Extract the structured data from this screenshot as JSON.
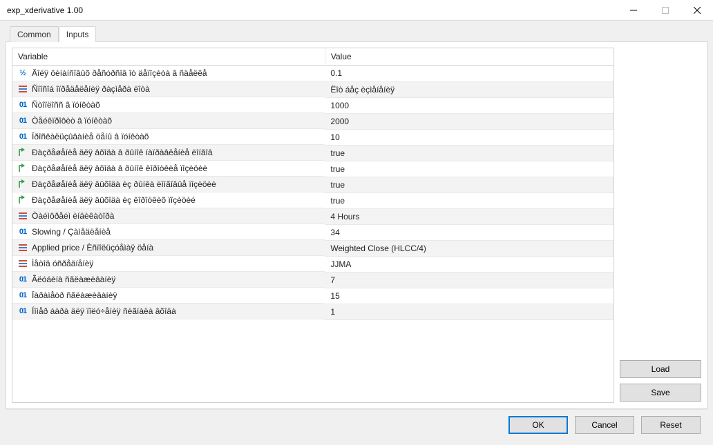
{
  "window": {
    "title": "exp_xderivative 1.00"
  },
  "tabs": {
    "common": "Common",
    "inputs": "Inputs"
  },
  "table": {
    "headers": {
      "variable": "Variable",
      "value": "Value"
    },
    "rows": [
      {
        "icon": "half-icon",
        "variable": "Äîëÿ ôèíàíñîâûõ ðåñóðñîâ îò äåïîçèòà â ñäåëêå",
        "value": "0.1"
      },
      {
        "icon": "stack-icon",
        "variable": "Ñïîñîá îïðåäåëåíèÿ ðàçìåðà ëîòà",
        "value": "Ëîò áåç èçìåíåíèÿ"
      },
      {
        "icon": "num-icon",
        "variable": "Ñòîïëîññ â ïóíêòàõ",
        "value": "1000"
      },
      {
        "icon": "num-icon",
        "variable": "Òåéêïðîôèò â ïóíêòàõ",
        "value": "2000"
      },
      {
        "icon": "num-icon",
        "variable": "Ïðîñêàëüçûâàíèå öåíû â ïóíêòàõ",
        "value": "10"
      },
      {
        "icon": "arrow-icon",
        "variable": "Ðàçðåøåíèå äëÿ âõîäà â ðûíîê íàïðàâëåíèå ëîíãîâ",
        "value": "true"
      },
      {
        "icon": "arrow-icon",
        "variable": "Ðàçðåøåíèå äëÿ âõîäà â ðûíîê êîðîòêèå ïîçèöèè",
        "value": "true"
      },
      {
        "icon": "arrow-icon",
        "variable": "Ðàçðåøåíèå äëÿ âûõîäà èç ðûíêà ëîíãîâûå ïîçèöèè",
        "value": "true"
      },
      {
        "icon": "arrow-icon",
        "variable": "Ðàçðåøåíèå äëÿ âûõîäà èç êîðîòêèõ ïîçèöèé",
        "value": "true"
      },
      {
        "icon": "stack-icon",
        "variable": "Òàéìôðåéì èíäèêàòîðà",
        "value": "4 Hours"
      },
      {
        "icon": "num-icon",
        "variable": "Slowing / Çàìåäëåíèå",
        "value": "34"
      },
      {
        "icon": "stack-icon",
        "variable": "Applied price / Èñïîëüçóåìàÿ öåíà",
        "value": "Weighted Close (HLCC/4)"
      },
      {
        "icon": "stack-icon",
        "variable": "Ìåòîä óñðåäíåíèÿ",
        "value": "JJMA"
      },
      {
        "icon": "num-icon",
        "variable": "Ãëóáèíà ñãëàæèâàíèÿ",
        "value": "7"
      },
      {
        "icon": "num-icon",
        "variable": "Ïàðàìåòð ñãëàæèâàíèÿ",
        "value": "15"
      },
      {
        "icon": "num-icon",
        "variable": "Íîìåð áàðà äëÿ ïîëó÷åíèÿ ñèãíàëà âõîäà",
        "value": "1"
      }
    ]
  },
  "buttons": {
    "load": "Load",
    "save": "Save",
    "ok": "OK",
    "cancel": "Cancel",
    "reset": "Reset"
  }
}
